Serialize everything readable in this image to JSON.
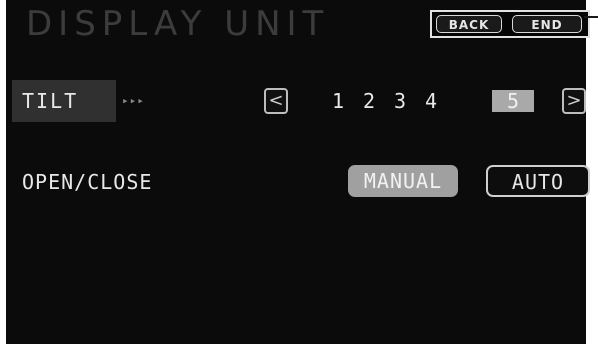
{
  "header": {
    "title": "DISPLAY UNIT",
    "back_label": "BACK",
    "end_label": "END"
  },
  "tilt": {
    "label": "TILT",
    "arrows": "▸▸▸",
    "prev_label": "<",
    "next_label": ">",
    "levels": [
      "1",
      "2",
      "3",
      "4",
      "5"
    ],
    "selected_level": "5"
  },
  "open_close": {
    "label": "OPEN/CLOSE",
    "manual_label": "MANUAL",
    "auto_label": "AUTO",
    "selected": "MANUAL"
  },
  "colors": {
    "background": "#0b0b0b",
    "highlight": "#a0a0a0",
    "text": "#e8e8e8"
  }
}
